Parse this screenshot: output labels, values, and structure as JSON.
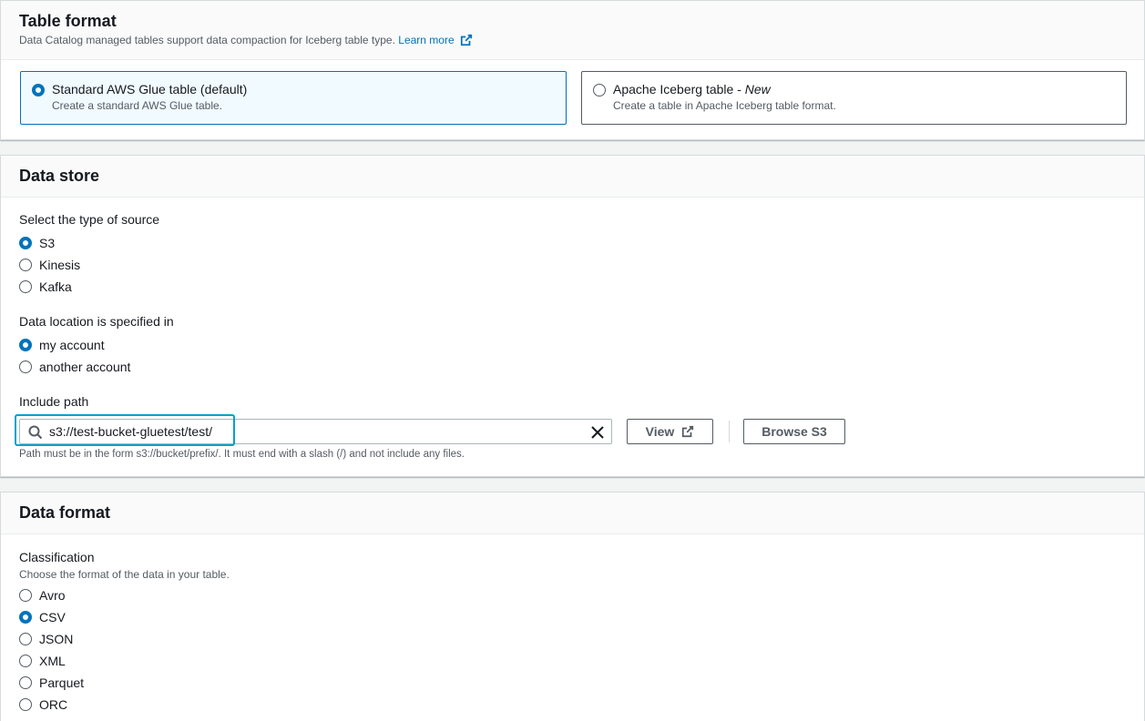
{
  "table_format": {
    "title": "Table format",
    "description": "Data Catalog managed tables support data compaction for Iceberg table type.",
    "learn_more": "Learn more",
    "tiles": [
      {
        "title": "Standard AWS Glue table (default)",
        "desc": "Create a standard AWS Glue table.",
        "selected": true
      },
      {
        "title_main": "Apache Iceberg table - ",
        "title_tag": "New",
        "desc": "Create a table in Apache Iceberg table format.",
        "selected": false
      }
    ]
  },
  "data_store": {
    "title": "Data store",
    "source_label": "Select the type of source",
    "sources": [
      "S3",
      "Kinesis",
      "Kafka"
    ],
    "selected_source": "S3",
    "location_label": "Data location is specified in",
    "locations": [
      "my account",
      "another account"
    ],
    "selected_location": "my account",
    "include_path_label": "Include path",
    "include_path_value": "s3://test-bucket-gluetest/test/",
    "view_button": "View",
    "browse_button": "Browse S3",
    "path_hint": "Path must be in the form s3://bucket/prefix/. It must end with a slash (/) and not include any files."
  },
  "data_format": {
    "title": "Data format",
    "classification_label": "Classification",
    "classification_desc": "Choose the format of the data in your table.",
    "options": [
      "Avro",
      "CSV",
      "JSON",
      "XML",
      "Parquet",
      "ORC"
    ],
    "selected": "CSV"
  },
  "colors": {
    "accent": "#0073bb",
    "focus": "#00a1c9"
  }
}
